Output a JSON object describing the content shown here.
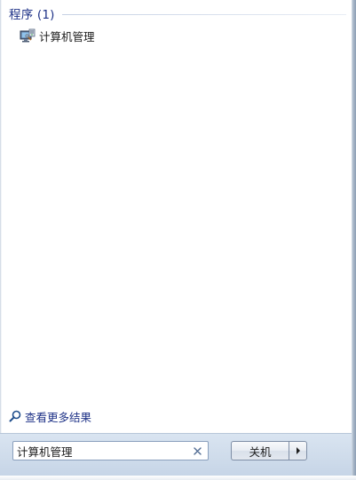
{
  "results": {
    "group_title": "程序 (1)",
    "items": [
      {
        "label": "计算机管理",
        "icon": "computer-management-icon"
      }
    ],
    "see_more_label": "查看更多结果"
  },
  "search": {
    "value": "计算机管理",
    "clear_icon": "close-icon"
  },
  "power": {
    "shutdown_label": "关机",
    "options_icon": "chevron-right-icon"
  },
  "colors": {
    "accent_text": "#1e3287",
    "bottom_strip": "#cfdceb"
  }
}
